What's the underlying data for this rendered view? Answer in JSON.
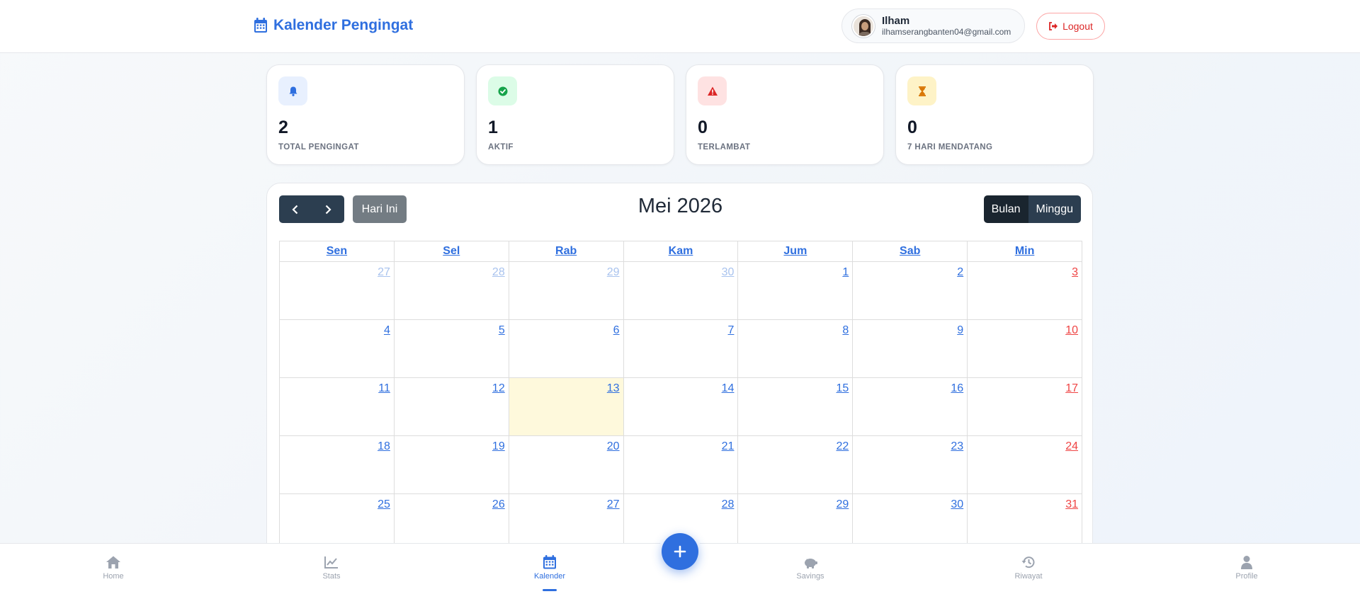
{
  "app": {
    "title": "Kalender Pengingat"
  },
  "user": {
    "name": "Ilham",
    "email": "ilhamserangbanten04@gmail.com",
    "logout_label": "Logout"
  },
  "stats": [
    {
      "value": "2",
      "label": "TOTAL PENGINGAT",
      "icon": "bell-icon",
      "icon_color": "#2f6fdf",
      "icon_bg": "#e8f0fe"
    },
    {
      "value": "1",
      "label": "AKTIF",
      "icon": "check-circle-icon",
      "icon_color": "#16a34a",
      "icon_bg": "#dcfce7"
    },
    {
      "value": "0",
      "label": "TERLAMBAT",
      "icon": "warning-icon",
      "icon_color": "#dc2626",
      "icon_bg": "#fee2e2"
    },
    {
      "value": "0",
      "label": "7 HARI MENDATANG",
      "icon": "hourglass-icon",
      "icon_color": "#d97706",
      "icon_bg": "#fef3c7"
    }
  ],
  "calendar": {
    "title": "Mei 2026",
    "today_label": "Hari Ini",
    "view_month": "Bulan",
    "view_week": "Minggu",
    "weekdays": [
      "Sen",
      "Sel",
      "Rab",
      "Kam",
      "Jum",
      "Sab",
      "Min"
    ],
    "weeks": [
      [
        "27",
        "28",
        "29",
        "30",
        "1",
        "2",
        "3"
      ],
      [
        "4",
        "5",
        "6",
        "7",
        "8",
        "9",
        "10"
      ],
      [
        "11",
        "12",
        "13",
        "14",
        "15",
        "16",
        "17"
      ],
      [
        "18",
        "19",
        "20",
        "21",
        "22",
        "23",
        "24"
      ],
      [
        "25",
        "26",
        "27",
        "28",
        "29",
        "30",
        "31"
      ]
    ],
    "today": "13",
    "accent": "#2f6fdf",
    "today_highlight": "#fef9dc",
    "sunday_color": "#ef4444"
  },
  "bottom_nav": [
    {
      "label": "Home",
      "icon": "home-icon"
    },
    {
      "label": "Stats",
      "icon": "chart-line-icon"
    },
    {
      "label": "Kalender",
      "icon": "calendar-icon",
      "active": true
    },
    {
      "label": "Savings",
      "icon": "piggy-bank-icon"
    },
    {
      "label": "Riwayat",
      "icon": "history-icon"
    },
    {
      "label": "Profile",
      "icon": "user-icon"
    }
  ],
  "fab": {
    "icon": "plus-icon"
  }
}
